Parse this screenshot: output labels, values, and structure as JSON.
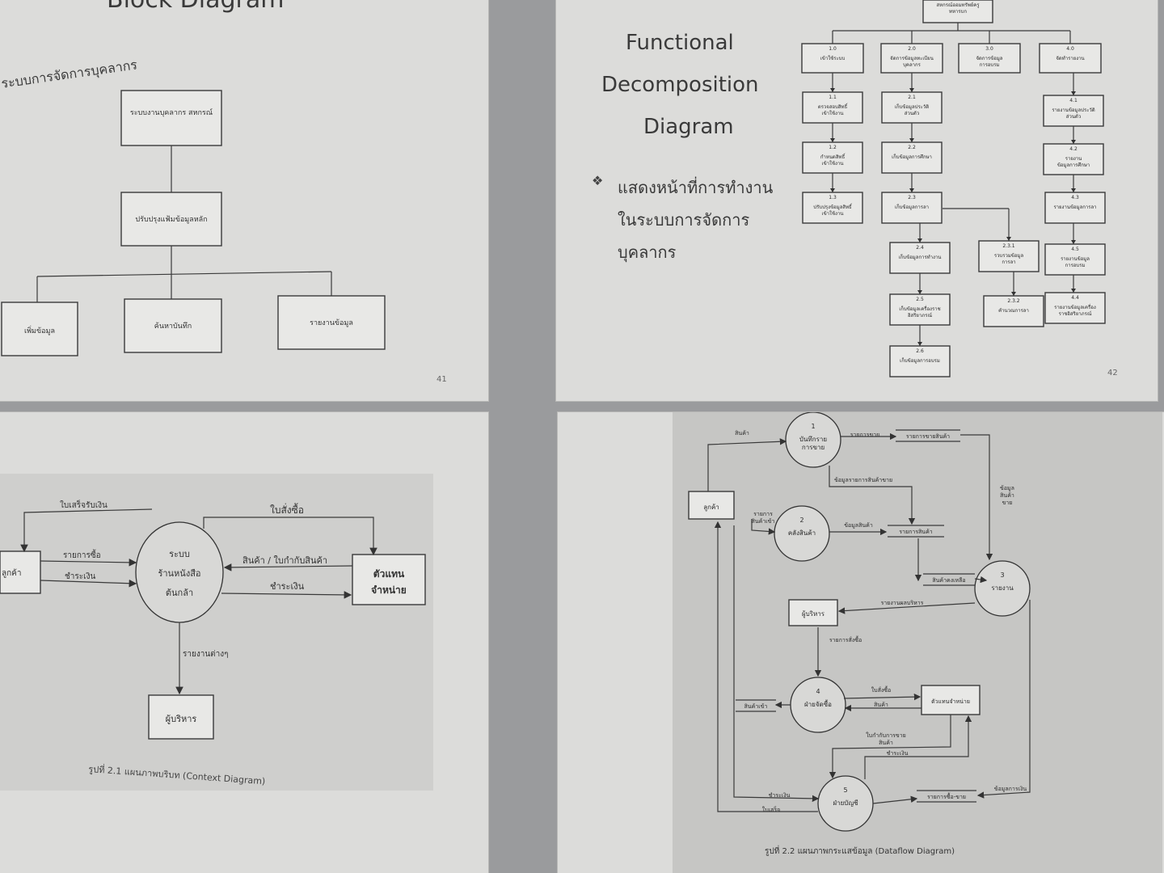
{
  "slide41": {
    "title": "Block Diagram",
    "subtitle": "ระบบการจัดการบุคลากร",
    "root": "ระบบงานบุคลากร สหกรณ์",
    "mid": "ปรับปรุงแฟ้มข้อมูลหลัก",
    "leaves": [
      "เพิ่มข้อมูล",
      "ค้นหาบันทึก",
      "รายงานข้อมูล"
    ],
    "page_number": "41"
  },
  "slide42": {
    "title_lines": [
      "Functional",
      "Decomposition",
      "Diagram"
    ],
    "bullet_icon": "diamond-cluster-icon",
    "bullet_lines": [
      "แสดงหน้าที่การทำงาน",
      "ในระบบการจัดการ",
      "บุคลากร"
    ],
    "root": "สหกรณ์ออมทรัพย์ครู ทหารบก",
    "page_number": "42",
    "columns": [
      {
        "id": "1.0",
        "label": "เข้าใช้ระบบ",
        "children": [
          {
            "id": "1.1",
            "label": "ตรวจสอบสิทธิ์ เข้าใช้งาน"
          },
          {
            "id": "1.2",
            "label": "กำหนดสิทธิ์ เข้าใช้งาน"
          },
          {
            "id": "1.3",
            "label": "ปรับปรุงข้อมูลสิทธิ์ เข้าใช้งาน"
          }
        ]
      },
      {
        "id": "2.0",
        "label": "จัดการข้อมูลทะเบียน บุคลากร",
        "children": [
          {
            "id": "2.1",
            "label": "เก็บข้อมูลประวัติ ส่วนตัว"
          },
          {
            "id": "2.2",
            "label": "เก็บข้อมูลการศึกษา"
          },
          {
            "id": "2.3",
            "label": "เก็บข้อมูลการลา"
          },
          {
            "id": "2.4",
            "label": "เก็บข้อมูลการทำงาน"
          },
          {
            "id": "2.5",
            "label": "เก็บข้อมูลเครื่องราช อิสริยาภรณ์"
          },
          {
            "id": "2.6",
            "label": "เก็บข้อมูลการอบรม"
          }
        ]
      },
      {
        "id": "3.0",
        "label": "จัดการข้อมูล การอบรม",
        "children": [
          {
            "id": "2.3.1",
            "label": "รวบรวมข้อมูล การลา"
          },
          {
            "id": "2.3.2",
            "label": "คำนวณการลา"
          }
        ]
      },
      {
        "id": "4.0",
        "label": "จัดทำรายงาน",
        "children": [
          {
            "id": "4.1",
            "label": "รายงานข้อมูลประวัติ ส่วนตัว"
          },
          {
            "id": "4.2",
            "label": "รายงาน ข้อมูลการศึกษา"
          },
          {
            "id": "4.3",
            "label": "รายงานข้อมูลการลา"
          },
          {
            "id": "4.5",
            "label": "รายงานข้อมูล การอบรม"
          },
          {
            "id": "4.4",
            "label": "รายงานข้อมูลเครื่อง ราชอิสริยาภรณ์"
          }
        ]
      }
    ]
  },
  "slide43": {
    "center": [
      "ระบบ",
      "ร้านหนังสือ",
      "ต้นกล้า"
    ],
    "left_entity": "ลูกค้า",
    "right_entity": [
      "ตัวแทน",
      "จำหน่าย"
    ],
    "bottom_entity": "ผู้บริหาร",
    "flows": {
      "top_left": "ใบเสร็จรับเงิน",
      "left_in_1": "รายการซื้อ",
      "left_in_2": "ชำระเงิน",
      "top_right": "ใบสั่งซื้อ",
      "right_in": "สินค้า / ใบกำกับสินค้า",
      "right_out": "ชำระเงิน",
      "down": "รายงานต่างๆ"
    },
    "caption": "รูปที่ 2.1 แผนภาพบริบท (Context Diagram)"
  },
  "slide44": {
    "caption": "รูปที่ 2.2 แผนภาพกระแสข้อมูล (Dataflow Diagram)",
    "processes": [
      {
        "num": "1",
        "label": "บันทึกราย การขาย"
      },
      {
        "num": "2",
        "label": "คลังสินค้า"
      },
      {
        "num": "3",
        "label": "รายงาน"
      },
      {
        "num": "4",
        "label": "ฝ่ายจัดซื้อ"
      },
      {
        "num": "5",
        "label": "ฝ่ายบัญชี"
      }
    ],
    "entities": {
      "customer": "ลูกค้า",
      "exec": "ผู้บริหาร",
      "agent": "ตัวแทนจำหน่าย"
    },
    "stores": [
      "รายการขายสินค้า",
      "รายการสินค้า",
      "สินค้าคงเหลือ",
      "สินค้าเข้า",
      "รายการซื้อ-ขาย"
    ],
    "flow_labels": {
      "f1": "สินค้า",
      "f2": "รายการขาย",
      "f3": "ข้อมูลรายการสินค้าขาย",
      "f4": "ข้อมูล สินค้า ขาย",
      "f5": "รายการ สินค้าเข้า",
      "f6": "ข้อมูลสินค้า",
      "f7": "รายงานผลบริหาร",
      "f8": "รายการสั่งซื้อ",
      "f9": "ใบสั่งซื้อ",
      "f10": "สินค้า",
      "f11": "ใบกำกับการขาย สินค้า",
      "f12": "ชำระเงิน",
      "f13": "ชำระเงิน",
      "f14": "ใบเสร็จ",
      "f15": "ข้อมูลการเงิน"
    }
  }
}
